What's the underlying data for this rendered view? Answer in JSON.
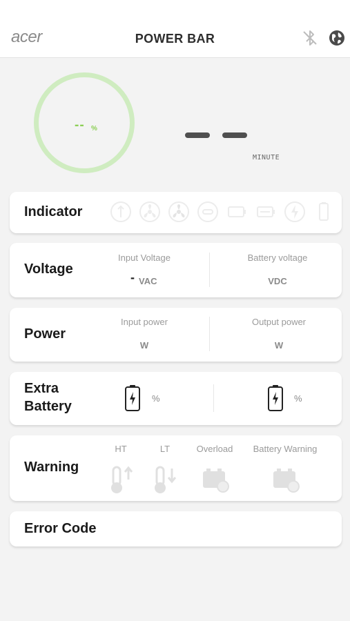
{
  "header": {
    "logo": "acer",
    "title": "POWER BAR",
    "icons": [
      "bluetooth-off-icon",
      "globe-icon"
    ]
  },
  "status": {
    "battery_percent": "--",
    "percent_unit": "%",
    "minute_label": "MINUTE"
  },
  "indicator": {
    "title": "Indicator",
    "icons": [
      "usb-a-icon",
      "fan-icon",
      "fan-alt-icon",
      "usb-c-icon",
      "battery-icon",
      "battery-alt-icon",
      "charge-icon",
      "cell-icon"
    ]
  },
  "voltage": {
    "title": "Voltage",
    "input_label": "Input Voltage",
    "input_value": "-",
    "input_unit": "VAC",
    "battery_label": "Battery voltage",
    "battery_unit": "VDC"
  },
  "power": {
    "title": "Power",
    "input_label": "Input power",
    "input_unit": "W",
    "output_label": "Output power",
    "output_unit": "W"
  },
  "extra_battery": {
    "title_line1": "Extra",
    "title_line2": "Battery",
    "battery1_unit": "%",
    "battery2_unit": "%"
  },
  "warning": {
    "title": "Warning",
    "ht_label": "HT",
    "lt_label": "LT",
    "overload_label": "Overload",
    "battery_warning_label": "Battery Warning"
  },
  "error": {
    "title": "Error Code"
  },
  "colors": {
    "accent_green": "#8ccf55",
    "ring_green": "#cfecc0",
    "faded_icon": "#e2e2e2"
  }
}
